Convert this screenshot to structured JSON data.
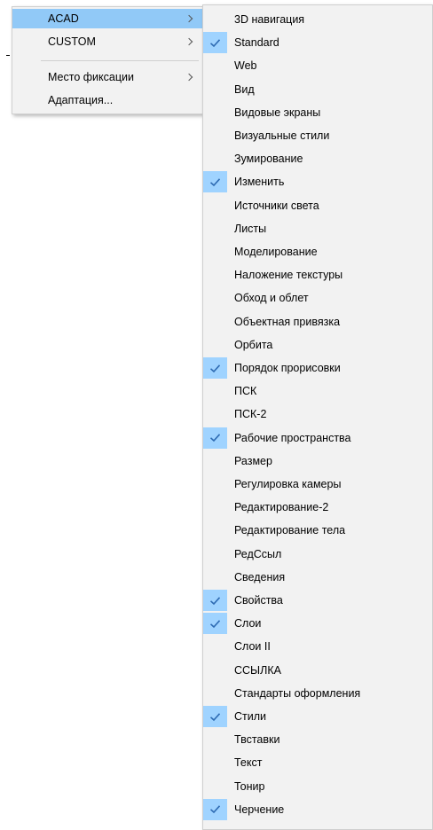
{
  "colors": {
    "menu_bg": "#f2f2f2",
    "highlight": "#91c9f7",
    "check_bg": "#9fd3ff",
    "check_mark": "#2e6bb3"
  },
  "main_menu": {
    "items": [
      {
        "label": "ACAD",
        "submenu": true,
        "highlighted": true
      },
      {
        "label": "CUSTOM",
        "submenu": true
      },
      {
        "label": "Место фиксации",
        "submenu": true
      },
      {
        "label": "Адаптация...",
        "submenu": false
      }
    ]
  },
  "submenu": {
    "items": [
      {
        "label": "3D навигация",
        "checked": false
      },
      {
        "label": "Standard",
        "checked": true
      },
      {
        "label": "Web",
        "checked": false
      },
      {
        "label": "Вид",
        "checked": false
      },
      {
        "label": "Видовые экраны",
        "checked": false
      },
      {
        "label": "Визуальные стили",
        "checked": false
      },
      {
        "label": "Зумирование",
        "checked": false
      },
      {
        "label": "Изменить",
        "checked": true
      },
      {
        "label": "Источники света",
        "checked": false
      },
      {
        "label": "Листы",
        "checked": false
      },
      {
        "label": "Моделирование",
        "checked": false
      },
      {
        "label": "Наложение текстуры",
        "checked": false
      },
      {
        "label": "Обход и облет",
        "checked": false
      },
      {
        "label": "Объектная привязка",
        "checked": false
      },
      {
        "label": "Орбита",
        "checked": false
      },
      {
        "label": "Порядок прорисовки",
        "checked": true
      },
      {
        "label": "ПСК",
        "checked": false
      },
      {
        "label": "ПСК-2",
        "checked": false
      },
      {
        "label": "Рабочие пространства",
        "checked": true
      },
      {
        "label": "Размер",
        "checked": false
      },
      {
        "label": "Регулировка камеры",
        "checked": false
      },
      {
        "label": "Редактирование-2",
        "checked": false
      },
      {
        "label": "Редактирование тела",
        "checked": false
      },
      {
        "label": "РедСсыл",
        "checked": false
      },
      {
        "label": "Сведения",
        "checked": false
      },
      {
        "label": "Свойства",
        "checked": true
      },
      {
        "label": "Слои",
        "checked": true
      },
      {
        "label": "Слои II",
        "checked": false
      },
      {
        "label": "ССЫЛКА",
        "checked": false
      },
      {
        "label": "Стандарты оформления",
        "checked": false
      },
      {
        "label": "Стили",
        "checked": true
      },
      {
        "label": "Твставки",
        "checked": false
      },
      {
        "label": "Текст",
        "checked": false
      },
      {
        "label": "Тонир",
        "checked": false
      },
      {
        "label": "Черчение",
        "checked": true
      }
    ]
  }
}
